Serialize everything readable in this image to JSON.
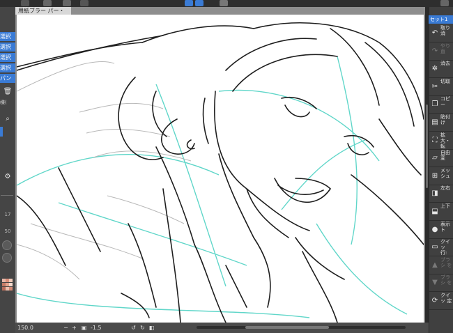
{
  "document_tab": {
    "title": "用紙ブラー パー・"
  },
  "left_panel": {
    "items": [
      {
        "label": "選択"
      },
      {
        "label": "選択"
      },
      {
        "label": "選択"
      },
      {
        "label": "選択"
      },
      {
        "label": "パン"
      }
    ],
    "text_label": "様(",
    "slider_values": [
      "17",
      "50"
    ],
    "color_swatches": [
      "#e8b7a8",
      "#d98f7a",
      "#f0c9b8",
      "#c47a66",
      "#e2a48e",
      "#f5d8cc",
      "#b56c5a",
      "#ecbfae",
      "#d48a75"
    ]
  },
  "statusbar": {
    "zoom": "150.0",
    "angle": "-1.5"
  },
  "right_panel": {
    "header": "セット1",
    "items": [
      {
        "label": "取り消",
        "icon": "undo-icon",
        "glyph": "↶",
        "disabled": false
      },
      {
        "label": "やり直",
        "icon": "redo-icon",
        "glyph": "↷",
        "disabled": true
      },
      {
        "label": "消去",
        "icon": "erase-icon",
        "glyph": "✲",
        "disabled": false
      },
      {
        "label": "切取",
        "icon": "cut-icon",
        "glyph": "✂",
        "disabled": false
      },
      {
        "label": "コピー",
        "icon": "copy-icon",
        "glyph": "❐",
        "disabled": false
      },
      {
        "label": "貼付け",
        "icon": "paste-icon",
        "glyph": "▤",
        "disabled": false
      },
      {
        "label": "拡大・転",
        "icon": "scale-rotate-icon",
        "glyph": "⛶",
        "disabled": false
      },
      {
        "label": "自由変",
        "icon": "free-transform-icon",
        "glyph": "▱",
        "disabled": false
      },
      {
        "label": "メッシュ",
        "icon": "mesh-icon",
        "glyph": "⊞",
        "disabled": false
      },
      {
        "label": "左右",
        "icon": "flip-horizontal-icon",
        "glyph": "◨",
        "disabled": false
      },
      {
        "label": "上下",
        "icon": "flip-vertical-icon",
        "glyph": "⬓",
        "disabled": false
      },
      {
        "label": "表示 ト",
        "icon": "display-icon",
        "glyph": "●",
        "disabled": false
      },
      {
        "label": "クイッ 行: 解",
        "icon": "quick-action-icon",
        "glyph": "▭",
        "disabled": false
      },
      {
        "label": "ブラシ を",
        "icon": "brush-up-icon",
        "glyph": "▲",
        "disabled": true
      },
      {
        "label": "ブラシ を",
        "icon": "brush-down-icon",
        "glyph": "▼",
        "disabled": true
      },
      {
        "label": "クイッ 定",
        "icon": "quick-setting-icon",
        "glyph": "⟳",
        "disabled": false
      }
    ]
  },
  "colors": {
    "accent": "#3a7bd5",
    "line_teal": "#45d0c0"
  }
}
